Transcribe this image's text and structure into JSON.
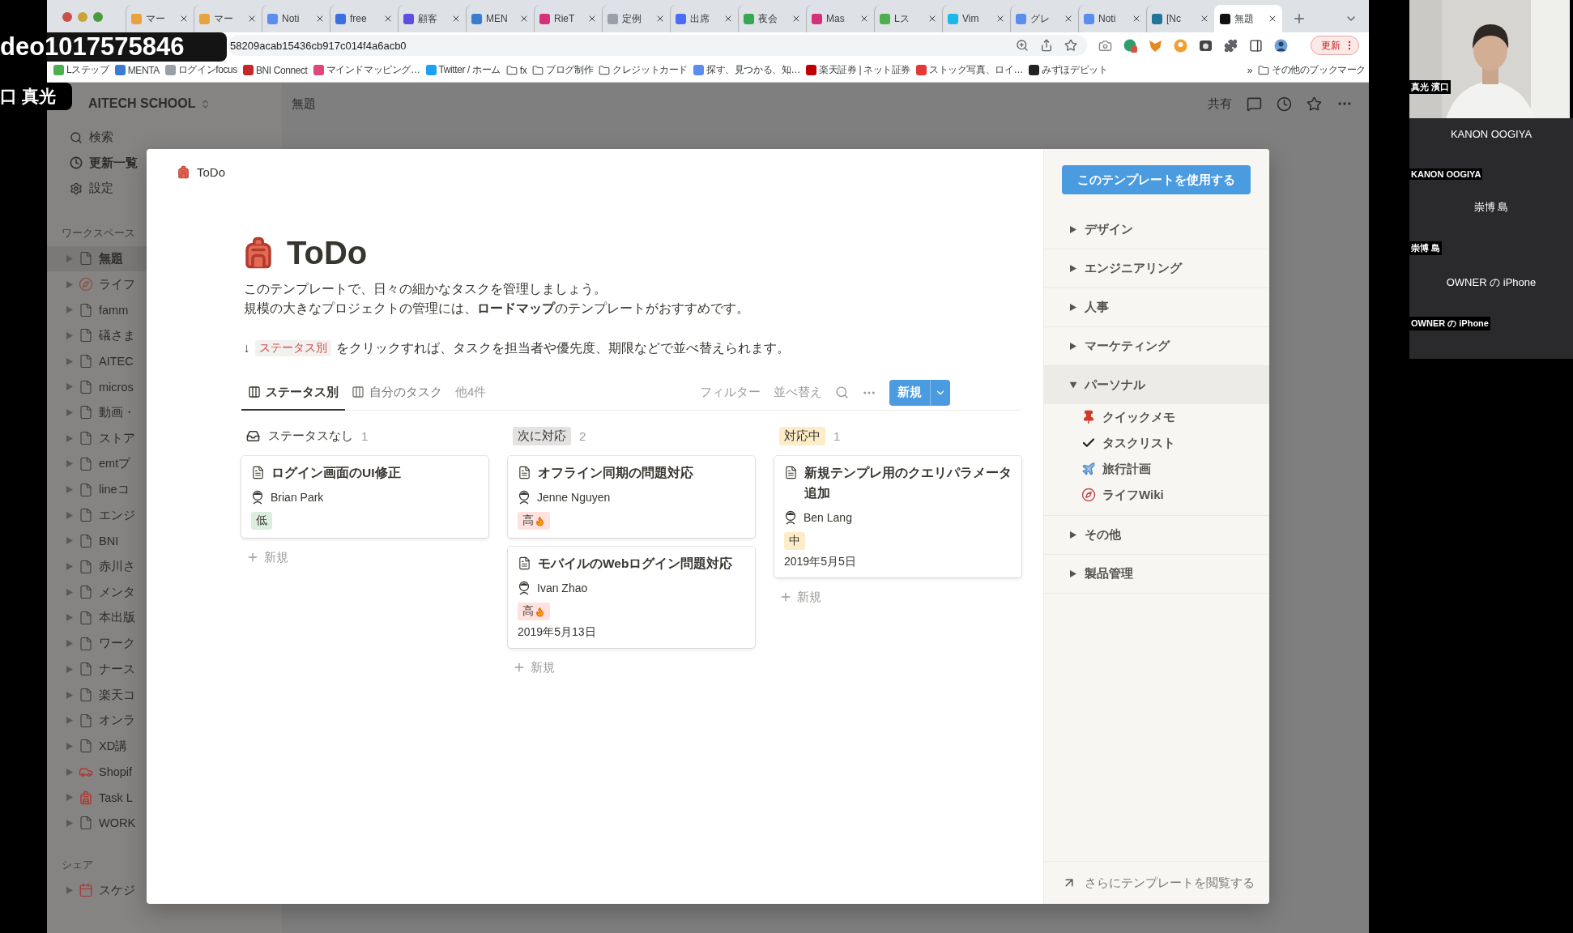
{
  "call": {
    "overlay_labels": [
      "deo1017575846",
      "口 真光"
    ],
    "tiles": [
      {
        "kind": "camera",
        "label": "真光 濱口"
      },
      {
        "kind": "name",
        "display": "KANON OOGIYA",
        "label": "KANON OOGIYA"
      },
      {
        "kind": "name",
        "display": "崇博 島",
        "label": "崇博 島"
      },
      {
        "kind": "name",
        "display": "OWNER の iPhone",
        "label": "OWNER の iPhone"
      }
    ]
  },
  "browser": {
    "tabs": [
      {
        "title": "マー",
        "color": "#e8a33d",
        "selected": false
      },
      {
        "title": "マー",
        "color": "#e8a33d",
        "selected": false
      },
      {
        "title": "Noti",
        "color": "#5b8def",
        "selected": false
      },
      {
        "title": "free",
        "color": "#3b6fe0",
        "selected": false
      },
      {
        "title": "顧客",
        "color": "#5b4fe0",
        "selected": false
      },
      {
        "title": "MEN",
        "color": "#3a7ccf",
        "selected": false
      },
      {
        "title": "RieT",
        "color": "#d6307a",
        "selected": false
      },
      {
        "title": "定例",
        "color": "#9aa0a6",
        "selected": false
      },
      {
        "title": "出席",
        "color": "#4a6cf7",
        "selected": false
      },
      {
        "title": "夜会",
        "color": "#34a853",
        "selected": false
      },
      {
        "title": "Mas",
        "color": "#d6307a",
        "selected": false
      },
      {
        "title": "Lス",
        "color": "#4caf50",
        "selected": false
      },
      {
        "title": "Vim",
        "color": "#1ab7ea",
        "selected": false
      },
      {
        "title": "グレ",
        "color": "#5b8def",
        "selected": false
      },
      {
        "title": "Noti",
        "color": "#5b8def",
        "selected": false
      },
      {
        "title": "[Nc",
        "color": "#21759b",
        "selected": false
      },
      {
        "title": "無題",
        "color": "#111111",
        "selected": true
      }
    ],
    "url": "58209acab15436cb917c014f4a6acb0",
    "update_button": "更新",
    "bookmarks": [
      {
        "kind": "site",
        "title": "Lステップ",
        "color": "#4caf50"
      },
      {
        "kind": "site",
        "title": "MENTA",
        "color": "#3a7ccf"
      },
      {
        "kind": "site",
        "title": "ログインfocus",
        "color": "#9aa0a6"
      },
      {
        "kind": "site",
        "title": "BNI Connect",
        "color": "#c62828"
      },
      {
        "kind": "site",
        "title": "マインドマッピング…",
        "color": "#e0457b"
      },
      {
        "kind": "site",
        "title": "Twitter / ホーム",
        "color": "#1da1f2"
      },
      {
        "kind": "folder",
        "title": "fx"
      },
      {
        "kind": "folder",
        "title": "ブログ制作"
      },
      {
        "kind": "folder",
        "title": "クレジットカード"
      },
      {
        "kind": "site",
        "title": "探す、見つかる、知…",
        "color": "#5b8def"
      },
      {
        "kind": "site",
        "title": "楽天証券 | ネット証券",
        "color": "#bf0000"
      },
      {
        "kind": "site",
        "title": "ストック写真、ロイ…",
        "color": "#e53935"
      },
      {
        "kind": "site",
        "title": "みずほデビット",
        "color": "#222222"
      }
    ],
    "bookmarks_more": "»",
    "other_bookmarks": "その他のブックマーク"
  },
  "notion": {
    "workspace": "AITECH SCHOOL",
    "nav": [
      {
        "kind": "search",
        "label": "検索"
      },
      {
        "kind": "updates",
        "label": "更新一覧"
      },
      {
        "kind": "settings",
        "label": "設定"
      }
    ],
    "workspace_label": "ワークスペース",
    "pages": [
      {
        "kind": "page",
        "title": "無題",
        "selected": true
      },
      {
        "kind": "compass",
        "title": "ライフ",
        "selected": false
      },
      {
        "kind": "page",
        "title": "famm",
        "selected": false
      },
      {
        "kind": "page",
        "title": "礒さま",
        "selected": false
      },
      {
        "kind": "page",
        "title": "AITEC",
        "selected": false
      },
      {
        "kind": "page",
        "title": "micros",
        "selected": false
      },
      {
        "kind": "page",
        "title": "動画・",
        "selected": false
      },
      {
        "kind": "page",
        "title": "ストア",
        "selected": false
      },
      {
        "kind": "page",
        "title": "emtプ",
        "selected": false
      },
      {
        "kind": "page",
        "title": "lineコ",
        "selected": false
      },
      {
        "kind": "page",
        "title": "エンジ",
        "selected": false
      },
      {
        "kind": "page",
        "title": "BNI",
        "selected": false
      },
      {
        "kind": "page",
        "title": "赤川さ",
        "selected": false
      },
      {
        "kind": "page",
        "title": "メンタ",
        "selected": false
      },
      {
        "kind": "page",
        "title": "本出版",
        "selected": false
      },
      {
        "kind": "page",
        "title": "ワーク",
        "selected": false
      },
      {
        "kind": "page",
        "title": "ナース",
        "selected": false
      },
      {
        "kind": "page",
        "title": "楽天コ",
        "selected": false
      },
      {
        "kind": "page",
        "title": "オンラ",
        "selected": false
      },
      {
        "kind": "page",
        "title": "XD講",
        "selected": false
      },
      {
        "kind": "car",
        "title": "Shopif",
        "selected": false
      },
      {
        "kind": "backpack",
        "title": "Task L",
        "selected": false
      },
      {
        "kind": "page",
        "title": "WORK",
        "selected": false
      }
    ],
    "shared_label": "シェア",
    "shared_pages": [
      {
        "kind": "calendar",
        "title": "スケジ",
        "selected": false
      }
    ],
    "topbar": {
      "title": "無題",
      "share": "共有"
    }
  },
  "modal": {
    "breadcrumb": "ToDo",
    "title": "ToDo",
    "description": [
      "このテンプレートで、日々の細かなタスクを管理しましょう。",
      "規模の大きなプロジェクトの管理には、**ロードマップ**のテンプレートがおすすめです。"
    ],
    "hint": {
      "arrow": "↓",
      "tag": "ステータス別",
      "text": "をクリックすれば、タスクを担当者や優先度、期限などで並べ替えられます。"
    },
    "views": [
      {
        "label": "ステータス別",
        "selected": true
      },
      {
        "label": "自分のタスク",
        "selected": false
      }
    ],
    "more_views": "他4件",
    "filter": "フィルター",
    "sort": "並べ替え",
    "new_button": "新規",
    "columns": [
      {
        "kind": "inbox",
        "title": "ステータスなし",
        "count": "1",
        "add": "新規",
        "cards": [
          {
            "title": "ログイン画面のUI修正",
            "assignee": "Brian Park",
            "priority": {
              "label": "低",
              "color": "#dbeddb",
              "flame": false
            }
          }
        ]
      },
      {
        "kind": "tag",
        "title": "次に対応",
        "color": "#e3e2e0",
        "count": "2",
        "add": "新規",
        "cards": [
          {
            "title": "オフライン同期の問題対応",
            "assignee": "Jenne Nguyen",
            "priority": {
              "label": "高",
              "color": "#ffe2dd",
              "flame": true
            }
          },
          {
            "title": "モバイルのWebログイン問題対応",
            "assignee": "Ivan Zhao",
            "priority": {
              "label": "高",
              "color": "#ffe2dd",
              "flame": true
            },
            "date": "2019年5月13日"
          }
        ]
      },
      {
        "kind": "tag",
        "title": "対応中",
        "color": "#fdecc8",
        "count": "1",
        "add": "新規",
        "cards": [
          {
            "title": "新規テンプレ用のクエリパラメータ追加",
            "assignee": "Ben Lang",
            "priority": {
              "label": "中",
              "color": "#fdecc8",
              "flame": false
            },
            "date": "2019年5月5日"
          }
        ]
      }
    ]
  },
  "template_panel": {
    "use_button": "このテンプレートを使用する",
    "categories": [
      {
        "label": "デザイン",
        "expanded": false
      },
      {
        "label": "エンジニアリング",
        "expanded": false
      },
      {
        "label": "人事",
        "expanded": false
      },
      {
        "label": "マーケティング",
        "expanded": false
      },
      {
        "label": "パーソナル",
        "expanded": true,
        "children": [
          {
            "kind": "pin",
            "label": "クイックメモ"
          },
          {
            "kind": "check",
            "label": "タスクリスト"
          },
          {
            "kind": "plane",
            "label": "旅行計画"
          },
          {
            "kind": "compass",
            "label": "ライフWiki"
          }
        ]
      },
      {
        "label": "その他",
        "expanded": false
      },
      {
        "label": "製品管理",
        "expanded": false
      }
    ],
    "browse": "さらにテンプレートを閲覧する"
  }
}
